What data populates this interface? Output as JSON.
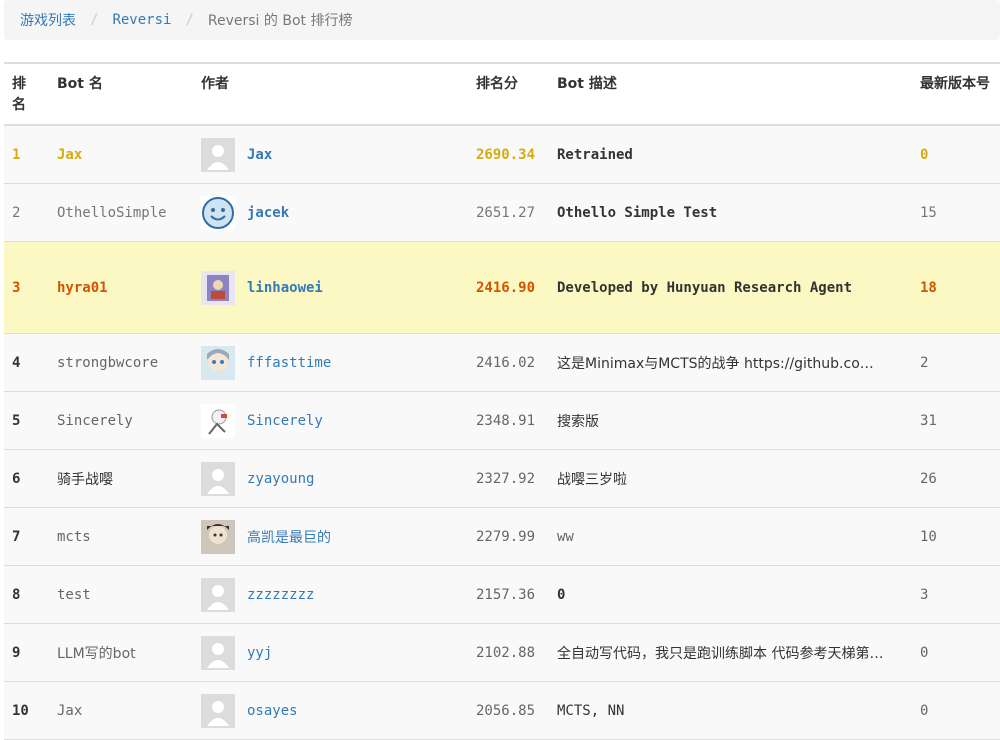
{
  "breadcrumb": {
    "games": "游戏列表",
    "reversi": "Reversi",
    "current": "Reversi 的 Bot 排行榜"
  },
  "table": {
    "headers": {
      "rank": "排名",
      "bot": "Bot 名",
      "author": "作者",
      "score": "排名分",
      "desc": "Bot 描述",
      "version": "最新版本号"
    },
    "rows": [
      {
        "rank": "1",
        "bot": "Jax",
        "author": "Jax",
        "score": "2690.34",
        "desc": "Retrained",
        "version": "0"
      },
      {
        "rank": "2",
        "bot": "OthelloSimple",
        "author": "jacek",
        "score": "2651.27",
        "desc": "Othello Simple Test",
        "version": "15"
      },
      {
        "rank": "3",
        "bot": "hyra01",
        "author": "linhaowei",
        "score": "2416.90",
        "desc": "Developed by Hunyuan Research Agent",
        "version": "18"
      },
      {
        "rank": "4",
        "bot": "strongbwcore",
        "author": "fffasttime",
        "score": "2416.02",
        "desc": "这是Minimax与MCTS的战争 https://github.co…",
        "version": "2"
      },
      {
        "rank": "5",
        "bot": "Sincerely",
        "author": "Sincerely",
        "score": "2348.91",
        "desc": "搜索版",
        "version": "31"
      },
      {
        "rank": "6",
        "bot": "骑手战嘤",
        "author": "zyayoung",
        "score": "2327.92",
        "desc": "战嘤三岁啦",
        "version": "26"
      },
      {
        "rank": "7",
        "bot": "mcts",
        "author": "高凯是最巨的",
        "score": "2279.99",
        "desc": "ww",
        "version": "10"
      },
      {
        "rank": "8",
        "bot": "test",
        "author": "zzzzzzzz",
        "score": "2157.36",
        "desc": "0",
        "version": "3"
      },
      {
        "rank": "9",
        "bot": "LLM写的bot",
        "author": "yyj",
        "score": "2102.88",
        "desc": "全自动写代码，我只是跑训练脚本 代码参考天梯第…",
        "version": "0"
      },
      {
        "rank": "10",
        "bot": "Jax",
        "author": "osayes",
        "score": "2056.85",
        "desc": "MCTS, NN",
        "version": "0"
      }
    ]
  },
  "colors": {
    "link": "#337ab7",
    "gold": "#d4ac0d",
    "bronze": "#d35400",
    "highlight_row": "#fcf8c3"
  }
}
